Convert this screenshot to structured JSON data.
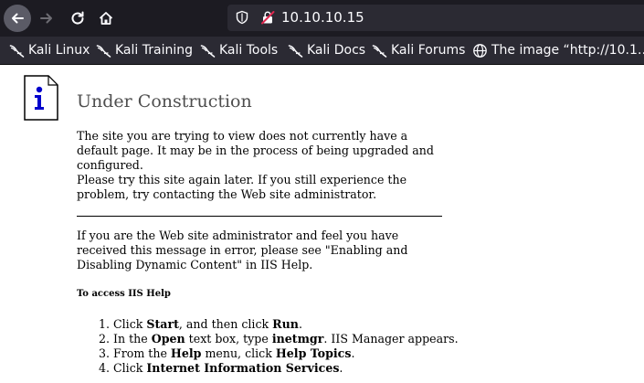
{
  "browser": {
    "url": "10.10.10.15",
    "bookmarks": [
      {
        "label": "Kali Linux",
        "icon": "kali-dragon-icon"
      },
      {
        "label": "Kali Training",
        "icon": "kali-dragon-icon"
      },
      {
        "label": "Kali Tools",
        "icon": "kali-dragon-icon"
      },
      {
        "label": "Kali Docs",
        "icon": "kali-dragon-icon"
      },
      {
        "label": "Kali Forums",
        "icon": "kali-dragon-icon"
      },
      {
        "label": "The image “http://10.1…",
        "icon": "globe-icon"
      }
    ]
  },
  "page": {
    "title": "Under Construction",
    "para1": "The site you are trying to view does not currently have a default page. It may be in the process of being upgraded and configured.",
    "para2": "Please try this site again later. If you still experience the problem, try contacting the Web site administrator.",
    "para3": "If you are the Web site administrator and feel you have received this message in error, please see \"Enabling and Disabling Dynamic Content\" in IIS Help.",
    "help_heading": "To access IIS Help",
    "steps": [
      {
        "num": "1.",
        "pre": "Click ",
        "b1": "Start",
        "mid": ", and then click ",
        "b2": "Run",
        "post": "."
      },
      {
        "num": "2.",
        "pre": "In the ",
        "b1": "Open",
        "mid": " text box, type ",
        "b2": "inetmgr",
        "post": ". IIS Manager appears."
      },
      {
        "num": "3.",
        "pre": "From the ",
        "b1": "Help",
        "mid": " menu, click ",
        "b2": "Help Topics",
        "post": "."
      },
      {
        "num": "4.",
        "pre": "Click ",
        "b1": "Internet Information Services",
        "mid": ".",
        "b2": "",
        "post": ""
      }
    ]
  },
  "colors": {
    "toolbar_bg": "#1c1b22",
    "bookmarks_bg": "#2b2a33",
    "title_gray": "#4e4e4e",
    "info_blue": "#0000cc"
  }
}
